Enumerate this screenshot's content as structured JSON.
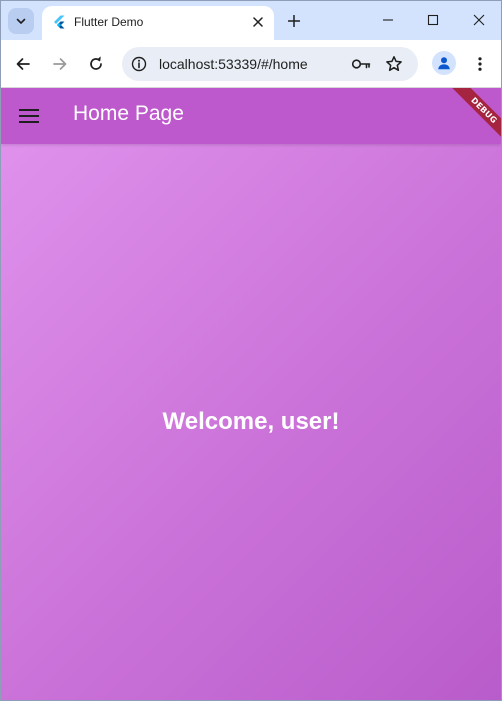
{
  "browser": {
    "tab": {
      "title": "Flutter Demo",
      "favicon": "flutter-logo-icon"
    },
    "address": {
      "url": "localhost:53339/#/home"
    },
    "colors": {
      "tabstrip": "#d3e3fd",
      "omnibox": "#e9eef6"
    }
  },
  "app": {
    "title": "Home Page",
    "debug_label": "DEBUG",
    "welcome_text": "Welcome, user!",
    "colors": {
      "appbar": "#bd59cd",
      "gradient_start": "#df91ec",
      "gradient_end": "#b95ccb",
      "debug_banner": "#a52440"
    }
  }
}
